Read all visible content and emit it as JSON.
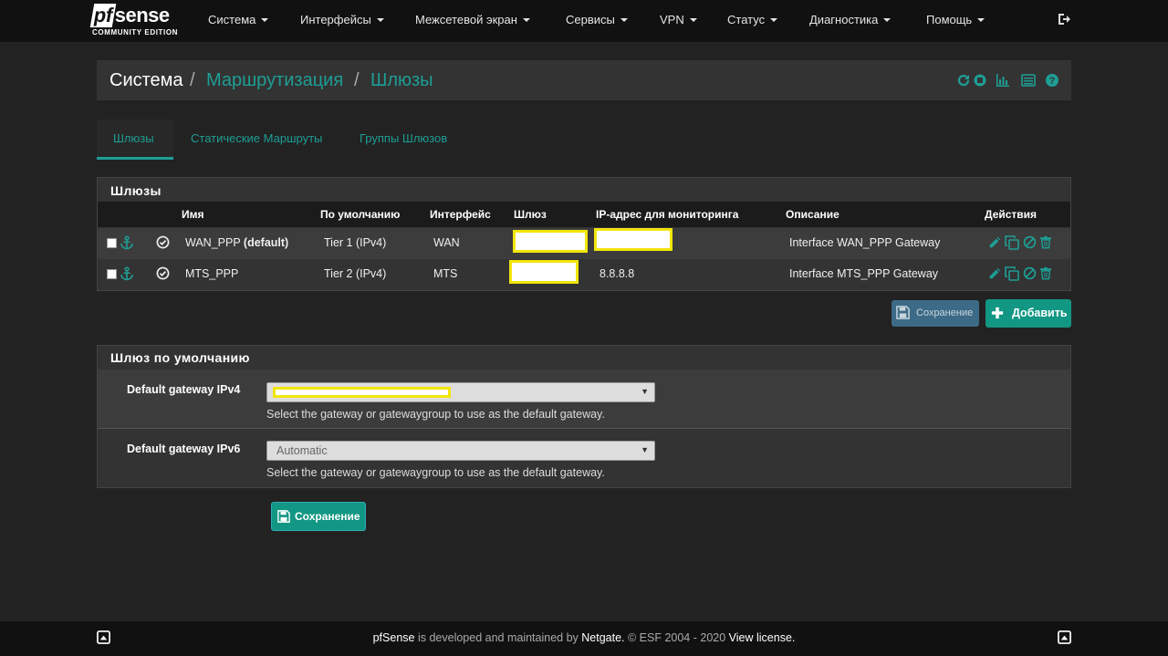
{
  "brand": {
    "name": "sense",
    "prefix": "pf",
    "edition": "COMMUNITY EDITION"
  },
  "nav": [
    {
      "label": "Система"
    },
    {
      "label": "Интерфейсы"
    },
    {
      "label": "Межсетевой экран"
    },
    {
      "label": "Сервисы"
    },
    {
      "label": "VPN"
    },
    {
      "label": "Статус"
    },
    {
      "label": "Диагностика"
    },
    {
      "label": "Помощь"
    }
  ],
  "breadcrumb": {
    "root": "Система",
    "level1": "Маршрутизация",
    "level2": "Шлюзы",
    "sep": "/"
  },
  "tabs": [
    {
      "label": "Шлюзы",
      "active": true
    },
    {
      "label": "Статические Маршруты",
      "active": false
    },
    {
      "label": "Группы Шлюзов",
      "active": false
    }
  ],
  "gateways_panel": {
    "title": "Шлюзы",
    "columns": {
      "name": "Имя",
      "default": "По умолчанию",
      "interface": "Интерфейс",
      "gateway": "Шлюз",
      "monitor": "IP-адрес для мониторинга",
      "description": "Описание",
      "actions": "Действия"
    },
    "rows": [
      {
        "name": "WAN_PPP",
        "name_suffix": "(default)",
        "tier": "Tier 1 (IPv4)",
        "interface": "WAN",
        "gateway": "",
        "monitor": "",
        "description": "Interface WAN_PPP Gateway"
      },
      {
        "name": "MTS_PPP",
        "name_suffix": "",
        "tier": "Tier 2 (IPv4)",
        "interface": "MTS",
        "gateway": "",
        "monitor": "8.8.8.8",
        "description": "Interface MTS_PPP Gateway"
      }
    ]
  },
  "buttons": {
    "save_small": "Сохранение",
    "add": "Добавить",
    "save_main": "Сохранение"
  },
  "default_gateway_panel": {
    "title": "Шлюз по умолчанию",
    "ipv4": {
      "label": "Default gateway IPv4",
      "value": "",
      "help": "Select the gateway or gatewaygroup to use as the default gateway."
    },
    "ipv6": {
      "label": "Default gateway IPv6",
      "value": "Automatic",
      "help": "Select the gateway or gatewaygroup to use as the default gateway."
    }
  },
  "footer": {
    "brand": "pfSense",
    "text1": " is developed and maintained by ",
    "company": "Netgate.",
    "text2": " © ESF 2004 - 2020 ",
    "license": "View license."
  },
  "colors": {
    "accent": "#1e9e95",
    "button": "#119783",
    "highlight": "#f2e60a"
  }
}
